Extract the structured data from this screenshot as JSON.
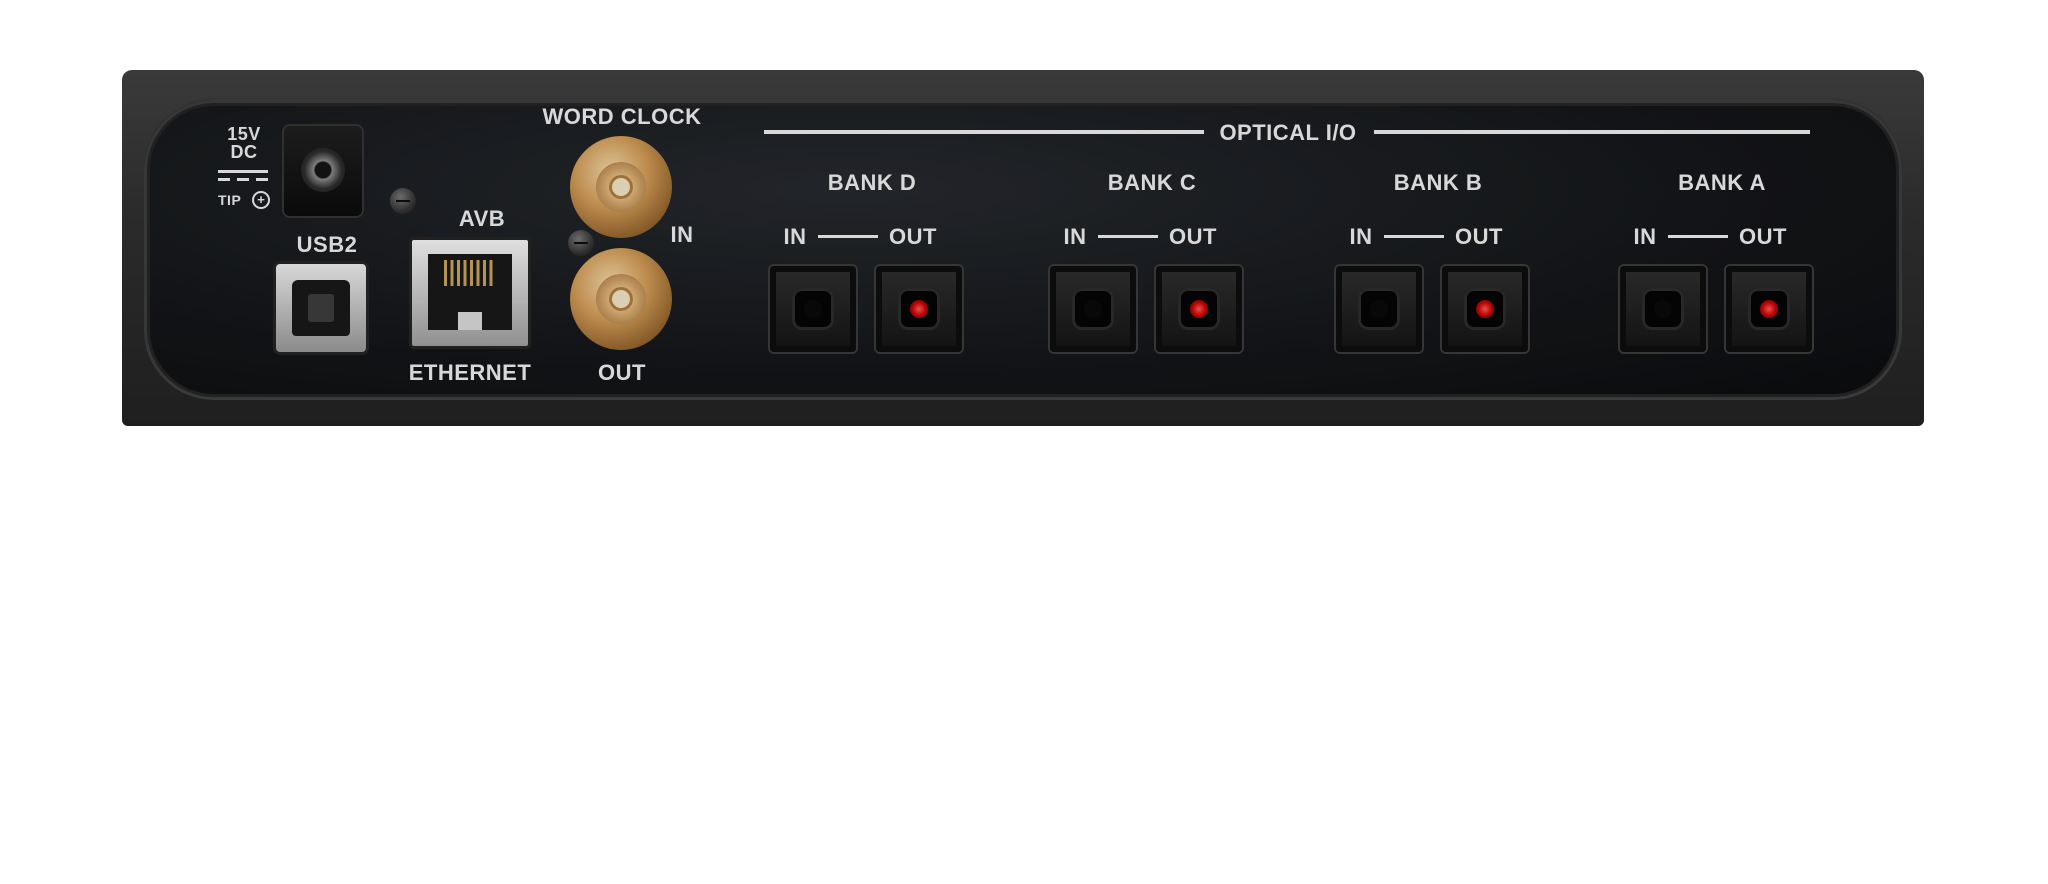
{
  "power": {
    "voltage": "15V",
    "type": "DC",
    "tip": "TIP",
    "icon": "plus-circle-icon"
  },
  "usb": {
    "label": "USB2"
  },
  "avb": {
    "top_label": "AVB",
    "bottom_label": "ETHERNET"
  },
  "word_clock": {
    "title": "WORD CLOCK",
    "in_label": "IN",
    "out_label": "OUT"
  },
  "optical": {
    "title": "OPTICAL I/O",
    "banks": [
      {
        "name": "BANK D",
        "in": "IN",
        "out": "OUT"
      },
      {
        "name": "BANK C",
        "in": "IN",
        "out": "OUT"
      },
      {
        "name": "BANK B",
        "in": "IN",
        "out": "OUT"
      },
      {
        "name": "BANK A",
        "in": "IN",
        "out": "OUT"
      }
    ]
  },
  "colors": {
    "panel": "#101215",
    "chassis": "#2b2b2b",
    "label": "#f2f2f2",
    "bnc_gold": "#d49c55",
    "led_red": "#d20000"
  }
}
